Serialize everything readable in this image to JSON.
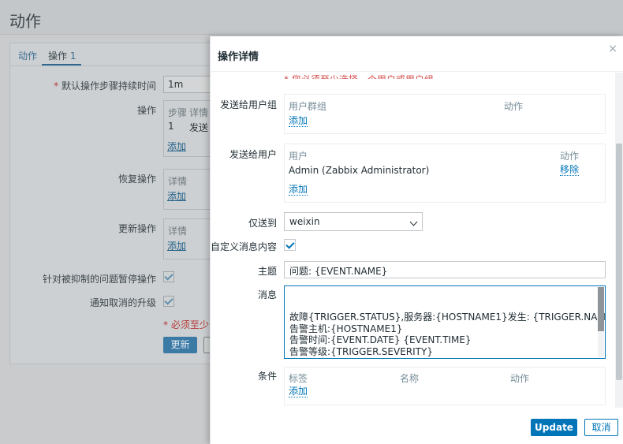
{
  "background": {
    "page_title": "动作",
    "tabs": [
      {
        "label": "动作"
      },
      {
        "label": "操作"
      }
    ],
    "tab_badge": "1",
    "labels": {
      "default_duration": "默认操作步骤持续时间",
      "operations": "操作",
      "recovery_operations": "恢复操作",
      "update_operations": "更新操作",
      "pause_suppressed": "针对被抑制的问题暂停操作",
      "notify_cancelled": "通知取消的升级"
    },
    "duration_value": "1m",
    "operations_table": {
      "col_step": "步骤",
      "col_details": "详情",
      "row_step": "1",
      "row_details": "发送",
      "add": "添加"
    },
    "recovery_table": {
      "col_details": "详情",
      "add": "添加"
    },
    "update_table": {
      "col_details": "详情",
      "add": "添加"
    },
    "required_note": "* 必须至少设",
    "update_button": "更新"
  },
  "modal": {
    "title": "操作详情",
    "close_glyph": "×",
    "note_partial": "* 您必须至少选择一个用户或用户组。",
    "send_to_groups": {
      "label": "发送给用户组",
      "col_group": "用户群组",
      "col_action": "动作",
      "add": "添加"
    },
    "send_to_users": {
      "label": "发送给用户",
      "col_user": "用户",
      "col_action": "动作",
      "user": "Admin (Zabbix Administrator)",
      "remove": "移除",
      "add": "添加"
    },
    "send_only_to": {
      "label": "仅送到",
      "value": "weixin"
    },
    "custom_message": {
      "label": "自定义消息内容",
      "checked": true
    },
    "subject": {
      "label": "主题",
      "value": "问题: {EVENT.NAME}"
    },
    "message": {
      "label": "消息",
      "value": "故障{TRIGGER.STATUS},服务器:{HOSTNAME1}发生: {TRIGGER.NAME}故障!\n告警主机:{HOSTNAME1}\n告警时间:{EVENT.DATE} {EVENT.TIME}\n告警等级:{TRIGGER.SEVERITY}\n告警信息: {TRIGGER.NAME}\n告警项目:{TRIGGER.KEY1}\n问题详情:{ITEM.NAME}:{ITEM.VALUE}"
    },
    "conditions": {
      "label": "条件",
      "col_label": "标签",
      "col_name": "名称",
      "col_action": "动作",
      "add": "添加"
    },
    "update_button": "Update",
    "cancel_button": "取消"
  }
}
